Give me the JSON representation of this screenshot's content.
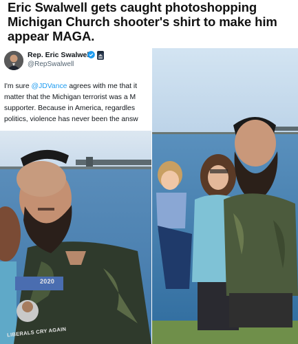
{
  "headline": {
    "line1": "Eric Swalwell gets caught photoshopping",
    "line2": "Michigan Church shooter's shirt to make him",
    "line3": "appear MAGA."
  },
  "tweet": {
    "author_name": "Rep. Eric Swalwell",
    "handle": "@RepSwalwell",
    "text_line1_prefix": "I'm sure ",
    "mention": "@JDVance",
    "text_line1_suffix": " agrees with me that it",
    "text_line2": "matter that the Michigan terrorist was a M",
    "text_line3": "supporter.  Because in America, regardles",
    "text_line4": "politics, violence has never been the answ",
    "verified_color": "#1d9bf0",
    "icons": [
      "verified-badge-icon",
      "government-badge-icon"
    ]
  },
  "left_photo": {
    "shirt_year": "2020",
    "shirt_slogan": "LIBERALS CRY AGAIN"
  },
  "colors": {
    "sky_left": "#d6e3ee",
    "water": "#4a7fb0",
    "right_sky": "#c9def0"
  }
}
